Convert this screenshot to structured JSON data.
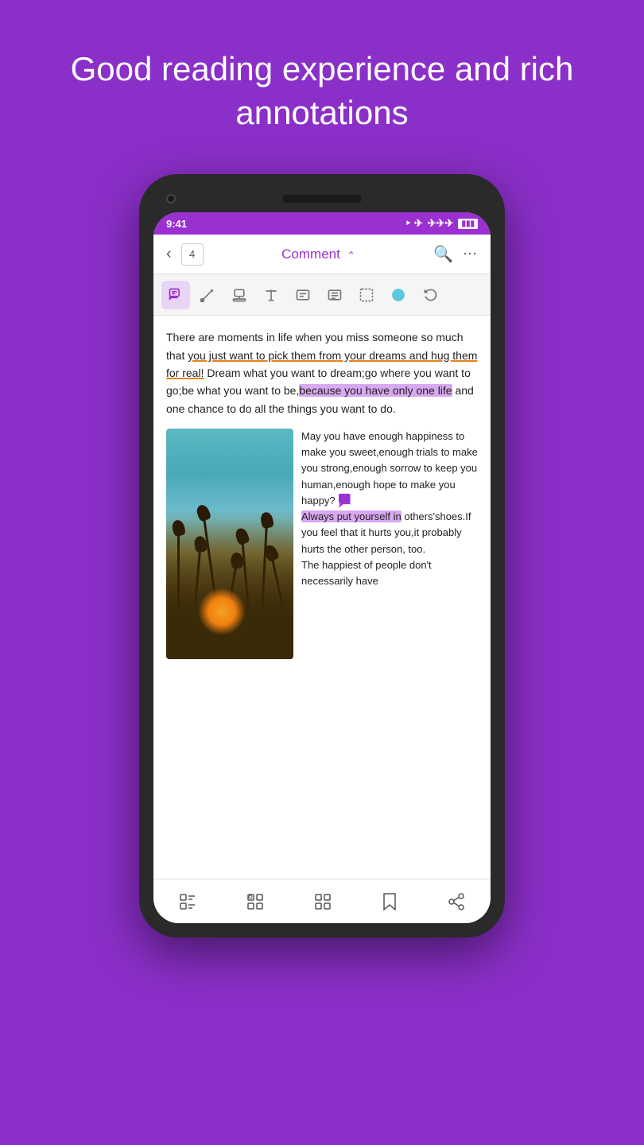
{
  "page": {
    "title_line1": "Good reading experience and rich",
    "title_line2": "annotations"
  },
  "status_bar": {
    "time": "9:41",
    "wifi": "WiFi",
    "signal": "Signal",
    "battery": "Battery"
  },
  "nav": {
    "back_label": "‹",
    "page_number": "4",
    "title": "Comment",
    "title_arrow": "⌃",
    "search_label": "Search",
    "more_label": "···"
  },
  "toolbar": {
    "tools": [
      {
        "name": "comment",
        "icon": "comment",
        "active": true
      },
      {
        "name": "annotate",
        "icon": "annotate",
        "active": false
      },
      {
        "name": "stamp",
        "icon": "stamp",
        "active": false
      },
      {
        "name": "text",
        "icon": "text",
        "active": false
      },
      {
        "name": "type",
        "icon": "type",
        "active": false
      },
      {
        "name": "form",
        "icon": "form",
        "active": false
      },
      {
        "name": "select",
        "icon": "select",
        "active": false
      },
      {
        "name": "circle",
        "icon": "circle",
        "active": false
      },
      {
        "name": "undo",
        "icon": "undo",
        "active": false
      }
    ]
  },
  "content": {
    "paragraph1": "There are moments in life when you miss someone so much that ",
    "paragraph1_underline": "you just want to pick them from your dreams and hug them for real!",
    "paragraph1_cont": " Dream what you want to dream;go where you want to go;be what you want to be,",
    "paragraph1_highlight": "because you have only one life",
    "paragraph1_end": " and one chance to do all the things you want to do.",
    "right_text_1": "May you have enough happiness to make you sweet,enough trials to make you strong,enough sorrow to keep you human,enough hope to make you happy? ",
    "right_text_highlight": "Always put yourself in",
    "right_text_2": " others'shoes.If you feel that it hurts you,it probably hurts the other person, too.",
    "right_text_3": "The happiest of people don't necessarily have"
  },
  "bottom_nav": {
    "items": [
      {
        "name": "contents",
        "label": "Contents"
      },
      {
        "name": "bookmarks",
        "label": "Bookmarks"
      },
      {
        "name": "apps",
        "label": "Apps"
      },
      {
        "name": "bookmark",
        "label": "Bookmark"
      },
      {
        "name": "share",
        "label": "Share"
      }
    ]
  }
}
